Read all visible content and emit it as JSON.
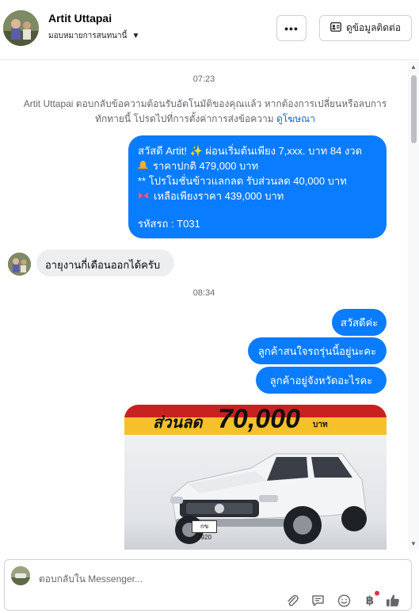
{
  "header": {
    "contact_name": "Artit Uttapai",
    "assign_label": "มอบหมายการสนทนานี้",
    "more_label": "•••",
    "view_contact_label": "ดูข้อมูลติดต่อ"
  },
  "chat": {
    "timestamp_1": "07:23",
    "system_note": "Artit Uttapai ตอบกลับข้อความต้อนรับอัตโนมัติของคุณแล้ว หากต้องการเปลี่ยนหรือลบการทักทายนี้ โปรดไปที่การตั้งค่าการส่งข้อความ",
    "system_link": "ดูโฆษณา",
    "promo": {
      "line1": "สวัสดี Artit! ✨  ผ่อนเริ่มต้นเพียง 7,xxx. บาท 84 งวด",
      "line2_icon": "bell-icon",
      "line2": "ราคาปกติ 479,000 บาท",
      "line3": "** โปรโมชั่นข้าวแลกลด รับส่วนลด 40,000 บาท",
      "line4_icon": "bow-icon",
      "line4": " เหลือเพียงราคา 439,000 บาท",
      "line5": " รหัสรถ : T031"
    },
    "incoming_1": "อายุงานกี่เดือนออกได้ครับ",
    "timestamp_2": "08:34",
    "outgoing_1": "สวัสดีค่ะ",
    "outgoing_2": "ลูกค้าสนใจรถรุ่นนี้อยู่นะคะ",
    "outgoing_3": "ลูกค้าอยู่จังหวัดอะไรคะ",
    "photo": {
      "discount_label": "ส่วนลด",
      "discount_amount": "70,000",
      "discount_unit": "บาท",
      "plate": "กข 7920"
    }
  },
  "composer": {
    "placeholder": "ตอบกลับใน Messenger...",
    "icons": [
      "attach-icon",
      "saved-reply-icon",
      "emoji-icon",
      "payment-baht-icon",
      "like-icon"
    ],
    "baht_symbol": "฿"
  },
  "colors": {
    "outgoing_bubble": "#0a7cff",
    "incoming_bubble": "#eceef0",
    "link": "#1763cf"
  }
}
